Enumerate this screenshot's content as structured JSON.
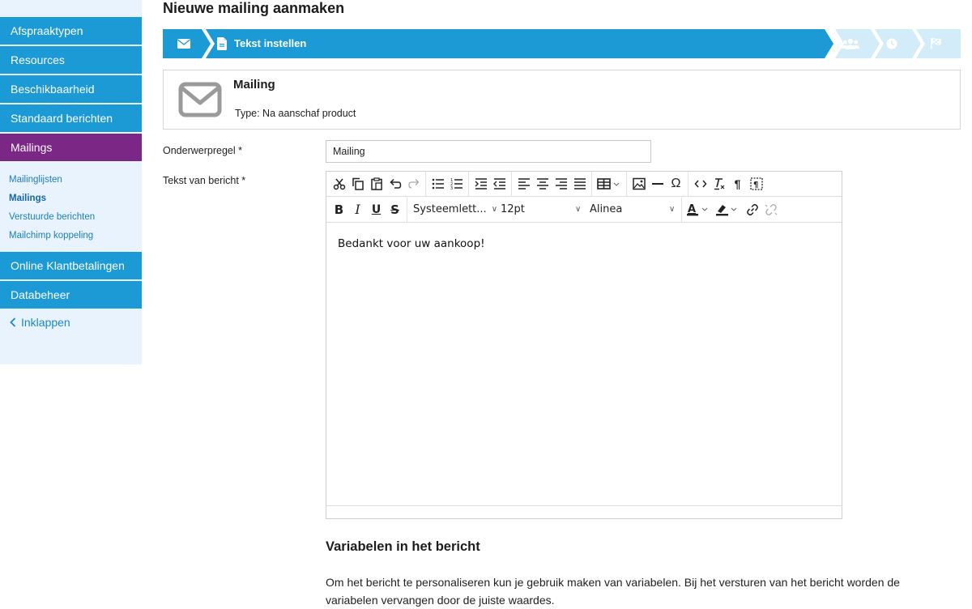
{
  "sidebar": {
    "items_top": [
      {
        "label": "Afspraaktypen"
      },
      {
        "label": "Resources"
      },
      {
        "label": "Beschikbaarheid"
      },
      {
        "label": "Standaard berichten"
      },
      {
        "label": "Mailings"
      }
    ],
    "subitems": [
      {
        "label": "Mailinglijsten"
      },
      {
        "label": "Mailings"
      },
      {
        "label": "Verstuurde berichten"
      },
      {
        "label": "Mailchimp koppeling"
      }
    ],
    "items_bottom": [
      {
        "label": "Online Klantbetalingen"
      },
      {
        "label": "Databeheer"
      }
    ],
    "collapse_label": "Inklappen",
    "colors": {
      "nav": "#1b9ad6",
      "active": "#7a2785",
      "background": "#e8f3fd"
    }
  },
  "page": {
    "title": "Nieuwe mailing aanmaken"
  },
  "steps": {
    "current_label": "Tekst instellen",
    "icons": [
      "envelope-icon",
      "document-icon",
      "users-icon",
      "clock-icon",
      "flag-icon"
    ],
    "colors": {
      "active": "#1b9ad6",
      "inactive": "#d3ecf9"
    }
  },
  "card": {
    "title": "Mailing",
    "type_text": "Type: Na aanschaf product",
    "icon": "envelope-outline-icon"
  },
  "form": {
    "subject_label": "Onderwerpregel *",
    "subject_value": "Mailing",
    "body_label": "Tekst van bericht *"
  },
  "editor": {
    "font_family": "Systeemlett...",
    "font_size": "12pt",
    "block_format": "Alinea",
    "content": "Bedankt voor uw aankoop!",
    "toolbar_row1": [
      "cut-icon",
      "copy-icon",
      "paste-icon",
      "undo-icon",
      "redo-icon",
      "bullet-list-icon",
      "numbered-list-icon",
      "indent-icon",
      "outdent-icon",
      "align-left-icon",
      "align-center-icon",
      "align-right-icon",
      "align-justify-icon",
      "table-icon",
      "image-icon",
      "horizontal-rule-icon",
      "special-char-icon",
      "source-code-icon",
      "clear-format-icon",
      "paragraph-icon",
      "show-blocks-icon"
    ],
    "toolbar_row2": [
      "bold-icon",
      "italic-icon",
      "underline-icon",
      "strikethrough-icon",
      "text-color-icon",
      "highlight-icon",
      "link-icon",
      "unlink-icon"
    ]
  },
  "variables": {
    "title": "Variabelen in het bericht",
    "text": "Om het bericht te personaliseren kun je gebruik maken van variabelen. Bij het versturen van het bericht worden de variabelen vervangen door de juiste waardes."
  }
}
